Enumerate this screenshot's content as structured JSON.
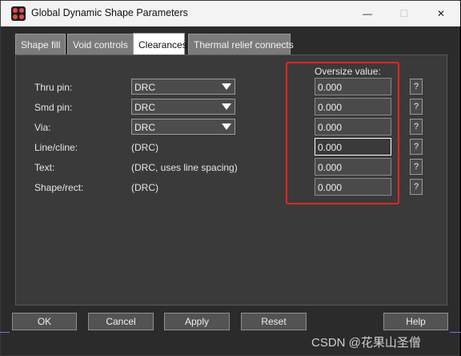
{
  "window": {
    "title": "Global Dynamic Shape Parameters",
    "minimize_glyph": "—",
    "maximize_glyph": "☐",
    "close_glyph": "✕"
  },
  "tabs": [
    {
      "label": "Shape fill",
      "active": false
    },
    {
      "label": "Void controls",
      "active": false
    },
    {
      "label": "Clearances",
      "active": true
    },
    {
      "label": "Thermal relief connects",
      "active": false
    }
  ],
  "clearances": {
    "oversize_label": "Oversize value:",
    "rows": [
      {
        "label": "Thru pin:",
        "value": "DRC",
        "type": "dropdown",
        "oversize": "0.000"
      },
      {
        "label": "Smd pin:",
        "value": "DRC",
        "type": "dropdown",
        "oversize": "0.000"
      },
      {
        "label": "Via:",
        "value": "DRC",
        "type": "dropdown",
        "oversize": "0.000"
      },
      {
        "label": "Line/cline:",
        "value": "(DRC)",
        "type": "static",
        "oversize": "0.000"
      },
      {
        "label": "Text:",
        "value": "(DRC, uses line spacing)",
        "type": "static",
        "oversize": "0.000"
      },
      {
        "label": "Shape/rect:",
        "value": "(DRC)",
        "type": "static",
        "oversize": "0.000"
      }
    ],
    "help_glyph": "?"
  },
  "buttons": {
    "ok": "OK",
    "cancel": "Cancel",
    "apply": "Apply",
    "reset": "Reset",
    "help": "Help"
  },
  "watermark": "CSDN @花果山圣僧",
  "colors": {
    "highlight": "#e0262b",
    "window_bg": "#2b2b2b",
    "panel_bg": "#3a3a3a"
  }
}
